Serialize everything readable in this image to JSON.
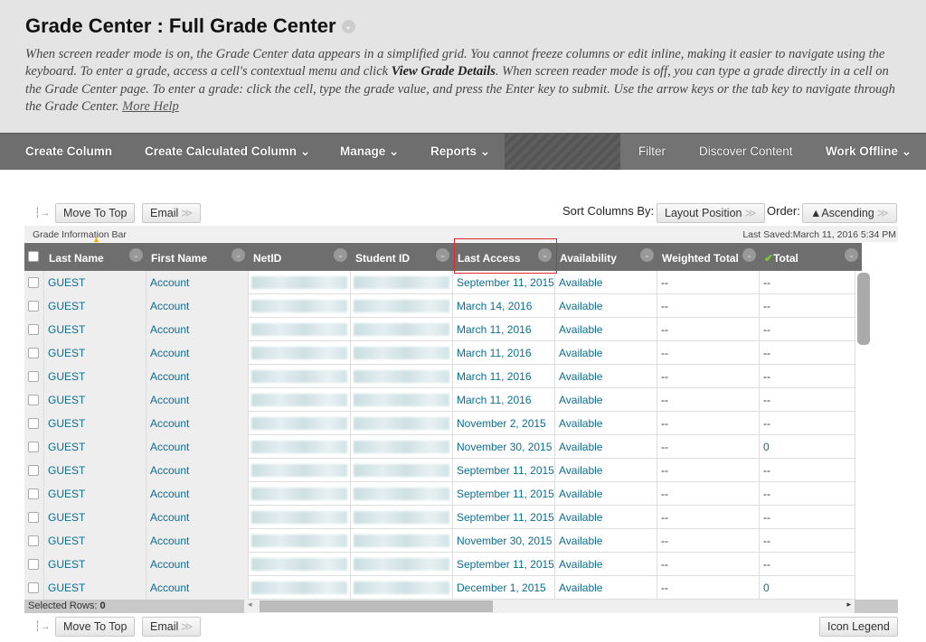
{
  "header": {
    "title": "Grade Center : Full Grade Center",
    "desc_1": "When screen reader mode is on, the Grade Center data appears in a simplified grid. You cannot freeze columns or edit inline, making it easier to navigate using the keyboard. To enter a grade, access a cell's contextual menu and click ",
    "desc_bold": "View Grade Details",
    "desc_2": ". When screen reader mode is off, you can type a grade directly in a cell on the Grade Center page. To enter a grade: click the cell, type the grade value, and press the Enter key to submit. Use the arrow keys or the tab key to navigate through the Grade Center. ",
    "more_help": "More Help"
  },
  "nav": {
    "create_column": "Create Column",
    "create_calculated": "Create Calculated Column",
    "manage": "Manage",
    "reports": "Reports",
    "filter": "Filter",
    "discover": "Discover Content",
    "work_offline": "Work Offline"
  },
  "toolbar": {
    "move_to_top": "Move To Top",
    "email": "Email",
    "sort_label": "Sort Columns By:",
    "sort_value": "Layout Position",
    "order_label": "Order:",
    "order_value": "▲Ascending",
    "icon_legend": "Icon Legend"
  },
  "infobar": {
    "label": "Grade Information Bar",
    "last_saved": "Last Saved:March 11, 2016 5:34 PM"
  },
  "columns": [
    "Last Name",
    "First Name",
    "NetID",
    "Student ID",
    "Last Access",
    "Availability",
    "Weighted Total",
    "Total"
  ],
  "rows": [
    {
      "last": "GUEST",
      "first": "Account",
      "access": "September 11, 2015",
      "avail": "Available",
      "weighted": "--",
      "total": "--"
    },
    {
      "last": "GUEST",
      "first": "Account",
      "access": "March 14, 2016",
      "avail": "Available",
      "weighted": "--",
      "total": "--"
    },
    {
      "last": "GUEST",
      "first": "Account",
      "access": "March 11, 2016",
      "avail": "Available",
      "weighted": "--",
      "total": "--"
    },
    {
      "last": "GUEST",
      "first": "Account",
      "access": "March 11, 2016",
      "avail": "Available",
      "weighted": "--",
      "total": "--"
    },
    {
      "last": "GUEST",
      "first": "Account",
      "access": "March 11, 2016",
      "avail": "Available",
      "weighted": "--",
      "total": "--"
    },
    {
      "last": "GUEST",
      "first": "Account",
      "access": "March 11, 2016",
      "avail": "Available",
      "weighted": "--",
      "total": "--"
    },
    {
      "last": "GUEST",
      "first": "Account",
      "access": "November 2, 2015",
      "avail": "Available",
      "weighted": "--",
      "total": "--"
    },
    {
      "last": "GUEST",
      "first": "Account",
      "access": "November 30, 2015",
      "avail": "Available",
      "weighted": "--",
      "total": "0"
    },
    {
      "last": "GUEST",
      "first": "Account",
      "access": "September 11, 2015",
      "avail": "Available",
      "weighted": "--",
      "total": "--"
    },
    {
      "last": "GUEST",
      "first": "Account",
      "access": "September 11, 2015",
      "avail": "Available",
      "weighted": "--",
      "total": "--"
    },
    {
      "last": "GUEST",
      "first": "Account",
      "access": "September 11, 2015",
      "avail": "Available",
      "weighted": "--",
      "total": "--"
    },
    {
      "last": "GUEST",
      "first": "Account",
      "access": "November 30, 2015",
      "avail": "Available",
      "weighted": "--",
      "total": "--"
    },
    {
      "last": "GUEST",
      "first": "Account",
      "access": "September 11, 2015",
      "avail": "Available",
      "weighted": "--",
      "total": "--"
    },
    {
      "last": "GUEST",
      "first": "Account",
      "access": "December 1, 2015",
      "avail": "Available",
      "weighted": "--",
      "total": "0"
    }
  ],
  "footer": {
    "selected_rows_label": "Selected Rows: ",
    "selected_rows": "0"
  },
  "colors": {
    "nav": "#6e6e6e",
    "link": "#0b6e91",
    "highlight": "#e1262d"
  }
}
